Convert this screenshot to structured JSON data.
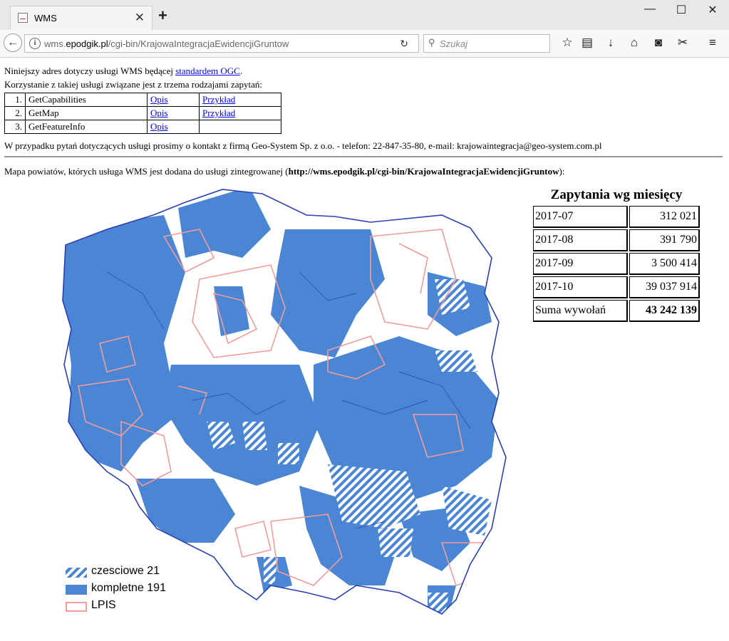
{
  "browser": {
    "tab_title": "WMS",
    "url_prefix": "wms.",
    "url_domain": "epodgik.pl",
    "url_path": "/cgi-bin/KrajowaIntegracjaEwidencjiGruntow",
    "search_placeholder": "Szukaj"
  },
  "page": {
    "intro_before": "Niniejszy adres dotyczy usługi WMS będącej ",
    "intro_link": "standardem OGC",
    "intro_after": ".",
    "line2": "Korzystanie z takiej usługi związane jest z trzema rodzajami zapytań:",
    "requests": [
      {
        "num": "1.",
        "name": "GetCapabilities",
        "desc": "Opis",
        "example": "Przykład"
      },
      {
        "num": "2.",
        "name": "GetMap",
        "desc": "Opis",
        "example": "Przykład"
      },
      {
        "num": "3.",
        "name": "GetFeatureInfo",
        "desc": "Opis",
        "example": ""
      }
    ],
    "contact": "W przypadku pytań dotyczących usługi prosimy o kontakt z firmą Geo-System Sp. z o.o. - telefon: 22-847-35-80, e-mail: krajowaintegracja@geo-system.com.pl",
    "map_caption_before": "Mapa powiatów, których usługa WMS jest dodana do usługi zintegrowanej (",
    "map_caption_url": "http://wms.epodgik.pl/cgi-bin/KrajowaIntegracjaEwidencjiGruntow",
    "map_caption_after": "):"
  },
  "stats": {
    "title": "Zapytania wg miesięcy",
    "rows": [
      {
        "month": "2017-07",
        "value": "312 021"
      },
      {
        "month": "2017-08",
        "value": "391 790"
      },
      {
        "month": "2017-09",
        "value": "3 500 414"
      },
      {
        "month": "2017-10",
        "value": "39 037 914"
      }
    ],
    "sum_label": "Suma wywołań",
    "sum_value": "43 242 139"
  },
  "legend": {
    "partial": "czesciowe 21",
    "complete": "kompletne 191",
    "lpis": "LPIS"
  },
  "colors": {
    "complete": "#4a86d4",
    "partial_stripe": "#4a86d4",
    "lpis": "#f29b9b",
    "border": "#2b3fb5"
  },
  "icons": {
    "back": "arrow-left-icon",
    "info": "info-icon",
    "reload": "reload-icon",
    "search": "magnifier-icon",
    "bookmark": "star-icon",
    "reader": "clipboard-icon",
    "download": "download-icon",
    "home": "home-icon",
    "pocket": "pocket-icon",
    "screenshot": "scissors-icon",
    "menu": "hamburger-icon"
  }
}
